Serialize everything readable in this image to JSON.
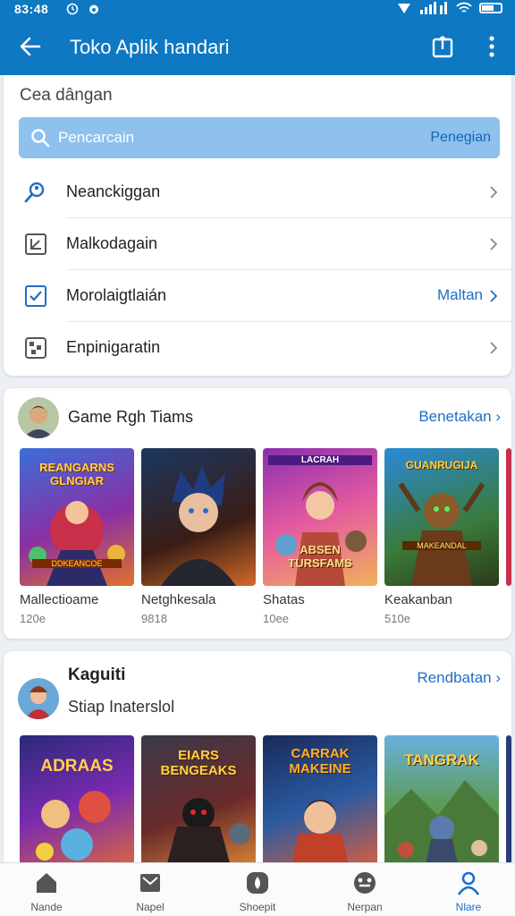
{
  "status_bar": {
    "time": "83:48",
    "icons": [
      "alarm-icon",
      "notification-icon",
      "wifi-icon",
      "signal-icon",
      "battery-icon"
    ]
  },
  "app_bar": {
    "title": "Toko Aplik handari"
  },
  "menu_section": {
    "label": "Cea dângan",
    "search": {
      "placeholder": "Pencarcain",
      "action": "Penegian"
    },
    "items": [
      {
        "label": "Neanckiggan",
        "extra": "",
        "icon": "user-search-icon"
      },
      {
        "label": "Malkodagain",
        "extra": "",
        "icon": "download-box-icon"
      },
      {
        "label": "Morolaigtlaián",
        "extra": "Maltan",
        "icon": "checkbox-icon"
      },
      {
        "label": "Enpinigaratin",
        "extra": "",
        "icon": "puzzle-icon"
      }
    ]
  },
  "game_section": {
    "title": "Game Rgh Tiams",
    "link": "Benetakan",
    "apps": [
      {
        "name": "Mallectioame",
        "size": "120e",
        "art_title": "REANGARNS GLNGIAR",
        "art_sub": "DDKEANCOE"
      },
      {
        "name": "Netghkesala",
        "size": "9818",
        "art_title": "",
        "art_sub": ""
      },
      {
        "name": "Shatas",
        "size": "10ee",
        "art_title": "ABSEN TURSFAMS",
        "art_sub": "LACRAH"
      },
      {
        "name": "Keakanban",
        "size": "510e",
        "art_title": "GUANRUGIJA",
        "art_sub": "MAKEANDAL"
      }
    ]
  },
  "kaguiti_section": {
    "title": "Kaguiti",
    "subtitle": "Stiap Inaterslol",
    "link": "Rendbatan",
    "apps": [
      {
        "art_title": "ADRAAS"
      },
      {
        "art_title": "EIARS BENGEAKS"
      },
      {
        "art_title": "CARRAK MAKEINE"
      },
      {
        "art_title": "TANGRAK"
      }
    ]
  },
  "bottom_nav": [
    {
      "label": "Nande",
      "icon": "home-icon",
      "active": false
    },
    {
      "label": "Napel",
      "icon": "inbox-icon",
      "active": false
    },
    {
      "label": "Shoepit",
      "icon": "drop-icon",
      "active": false
    },
    {
      "label": "Nerpan",
      "icon": "face-icon",
      "active": false
    },
    {
      "label": "Nlare",
      "icon": "profile-icon",
      "active": true
    }
  ],
  "colors": {
    "primary": "#0e78c2",
    "link": "#1e6fc4",
    "search_bg": "#8ec1ee"
  }
}
